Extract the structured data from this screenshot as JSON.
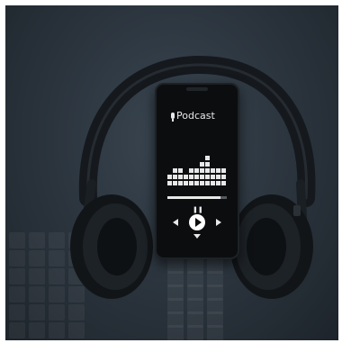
{
  "podcast_screen": {
    "title": "Podcast"
  },
  "player": {
    "progress": 0.9,
    "equalizer_levels": [
      2,
      3,
      3,
      2,
      3,
      3,
      4,
      5,
      3,
      3,
      3
    ]
  },
  "icons": {
    "mic": "microphone-icon",
    "pause": "pause-icon",
    "play": "play-icon",
    "prev": "previous-icon",
    "next": "next-icon",
    "down": "chevron-down-icon"
  },
  "colors": {
    "background": "#2a333c",
    "phone": "#0b0d0f",
    "screen_foreground": "#e8e8e8"
  }
}
